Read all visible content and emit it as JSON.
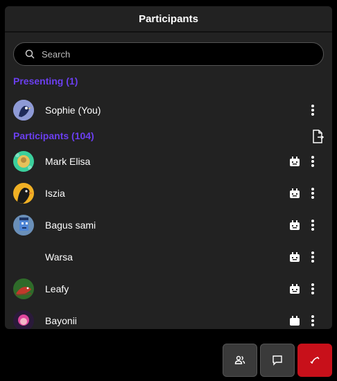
{
  "panel": {
    "title": "Participants",
    "search_placeholder": "Search"
  },
  "presenting": {
    "label": "Presenting (1)",
    "items": [
      {
        "name": "Sophie (You)",
        "avatar": "bird-avatar"
      }
    ]
  },
  "participants": {
    "label": "Participants (104)",
    "items": [
      {
        "name": "Mark Elisa",
        "avatar": "pattern-avatar"
      },
      {
        "name": "Iszia",
        "avatar": "bird-avatar"
      },
      {
        "name": "Bagus sami",
        "avatar": "pixel-avatar"
      },
      {
        "name": "Warsa",
        "avatar": ""
      },
      {
        "name": "Leafy",
        "avatar": "bird-avatar"
      },
      {
        "name": "Bayonii",
        "avatar": "character-avatar"
      }
    ]
  },
  "colors": {
    "accent": "#6b3ff0",
    "panel_bg": "#222222",
    "end_call": "#c8101a"
  },
  "icons": {
    "search": "search-icon",
    "more": "more-vertical-icon",
    "mute": "mic-off-icon",
    "export": "file-export-icon",
    "participants_toggle": "users-icon",
    "chat": "chat-icon",
    "end_call": "phone-hangup-icon"
  }
}
